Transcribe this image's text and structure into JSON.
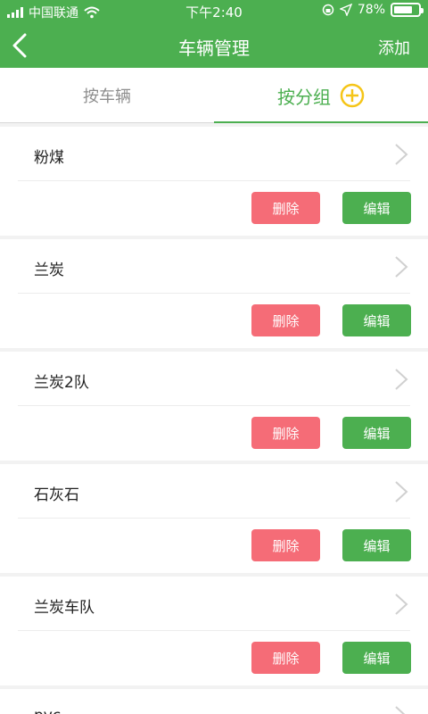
{
  "status_bar": {
    "carrier": "中国联通",
    "time": "下午2:40",
    "battery_percent": "78%",
    "battery_level": 0.78
  },
  "nav": {
    "title": "车辆管理",
    "add_label": "添加"
  },
  "tabs": {
    "by_vehicle": "按车辆",
    "by_group": "按分组"
  },
  "groups": [
    {
      "name": "粉煤"
    },
    {
      "name": "兰炭"
    },
    {
      "name": "兰炭2队"
    },
    {
      "name": "石灰石"
    },
    {
      "name": "兰炭车队"
    }
  ],
  "partial_group": {
    "name": "pvc"
  },
  "actions": {
    "delete_label": "删除",
    "edit_label": "编辑"
  },
  "colors": {
    "primary": "#4caf50",
    "danger": "#f56c77",
    "add_icon": "#f5c518"
  }
}
